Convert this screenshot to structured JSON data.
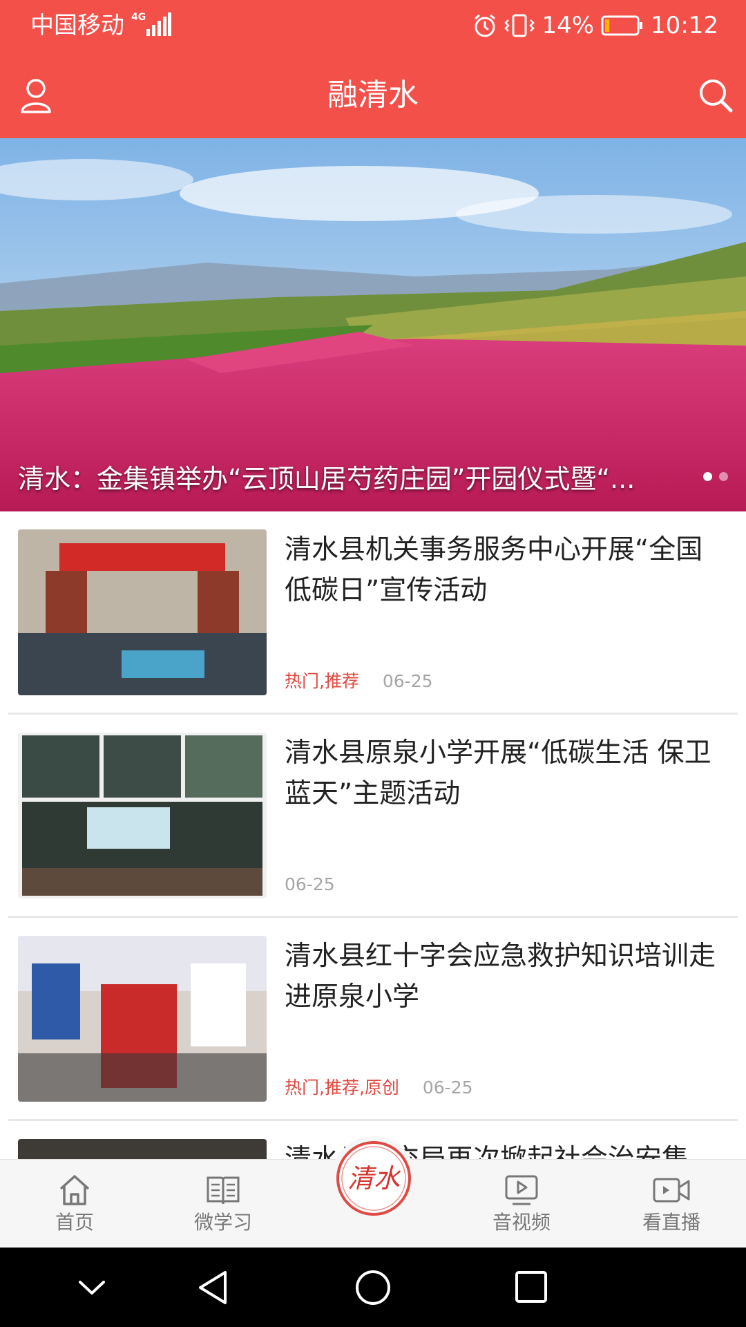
{
  "status_bar": {
    "carrier": "中国移动",
    "network": "4G",
    "battery": "14%",
    "time": "10:12",
    "battery_level": 0.14
  },
  "header": {
    "title": "融清水",
    "profile_icon": "user-icon",
    "search_icon": "search-icon"
  },
  "banner": {
    "caption": "清水：金集镇举办“云顶山居芍药庄园”开园仪式暨“...",
    "slides": 2,
    "active_slide": 1
  },
  "news": [
    {
      "title": "清水县机关事务服务中心开展“全国低碳日”宣传活动",
      "tags": "热门,推荐",
      "date": "06-25"
    },
    {
      "title": "清水县原泉小学开展“低碳生活 保卫蓝天”主题活动",
      "tags": "",
      "date": "06-25"
    },
    {
      "title": "清水县红十字会应急救护知识培训走进原泉小学",
      "tags": "热门,推荐,原创",
      "date": "06-25"
    },
    {
      "title": "清水县…交局再次掀起社会治安集…",
      "tags": "",
      "date": ""
    }
  ],
  "bottom_nav": {
    "items": [
      {
        "label": "首页",
        "icon": "home-icon"
      },
      {
        "label": "微学习",
        "icon": "book-icon"
      },
      {
        "label": "音视频",
        "icon": "play-icon"
      },
      {
        "label": "看直播",
        "icon": "video-camera-icon"
      }
    ],
    "center_logo_text": "清水"
  },
  "colors": {
    "brand_red": "#f4504a",
    "tag_red": "#e0473f",
    "date_gray": "#a5a5a5"
  }
}
